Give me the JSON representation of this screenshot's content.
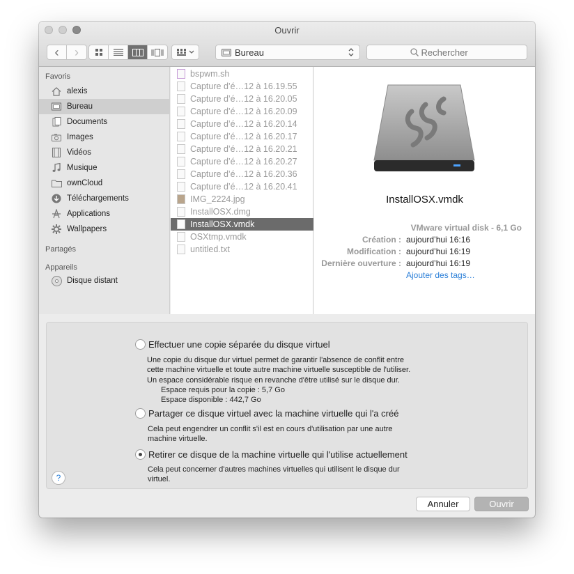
{
  "window": {
    "title": "Ouvrir"
  },
  "toolbar": {
    "back_glyph": "‹",
    "forward_glyph": "›",
    "location": "Bureau",
    "search_placeholder": "Rechercher"
  },
  "sidebar": {
    "favorites_header": "Favoris",
    "favorites": [
      {
        "label": "alexis",
        "icon": "home-icon"
      },
      {
        "label": "Bureau",
        "icon": "desktop-icon",
        "selected": true
      },
      {
        "label": "Documents",
        "icon": "documents-icon"
      },
      {
        "label": "Images",
        "icon": "camera-icon"
      },
      {
        "label": "Vidéos",
        "icon": "film-icon"
      },
      {
        "label": "Musique",
        "icon": "music-icon"
      },
      {
        "label": "ownCloud",
        "icon": "folder-icon"
      },
      {
        "label": "Téléchargements",
        "icon": "download-icon"
      },
      {
        "label": "Applications",
        "icon": "applications-icon"
      },
      {
        "label": "Wallpapers",
        "icon": "gear-icon"
      }
    ],
    "shared_header": "Partagés",
    "devices_header": "Appareils",
    "devices": [
      {
        "label": "Disque distant",
        "icon": "disc-icon"
      }
    ]
  },
  "files": [
    {
      "name": "bspwm.sh"
    },
    {
      "name": "Capture d’é…12 à 16.19.55"
    },
    {
      "name": "Capture d’é…12 à 16.20.05"
    },
    {
      "name": "Capture d’é…12 à 16.20.09"
    },
    {
      "name": "Capture d’é…12 à 16.20.14"
    },
    {
      "name": "Capture d’é…12 à 16.20.17"
    },
    {
      "name": "Capture d’é…12 à 16.20.21"
    },
    {
      "name": "Capture d’é…12 à 16.20.27"
    },
    {
      "name": "Capture d’é…12 à 16.20.36"
    },
    {
      "name": "Capture d’é…12 à 16.20.41"
    },
    {
      "name": "IMG_2224.jpg"
    },
    {
      "name": "InstallOSX.dmg"
    },
    {
      "name": "InstallOSX.vmdk",
      "selected": true
    },
    {
      "name": "OSXtmp.vmdk"
    },
    {
      "name": "untitled.txt"
    }
  ],
  "preview": {
    "name": "InstallOSX.vmdk",
    "kind": "VMware virtual disk - 6,1 Go",
    "created_label": "Création :",
    "created_value": "aujourd’hui 16:16",
    "modified_label": "Modification :",
    "modified_value": "aujourd’hui 16:19",
    "opened_label": "Dernière ouverture :",
    "opened_value": "aujourd’hui 16:19",
    "tags_link": "Ajouter des tags…"
  },
  "options": {
    "copy_title": "Effectuer une copie séparée du disque virtuel",
    "copy_desc_1": "Une copie du disque dur virtuel permet de garantir l'absence de conflit entre",
    "copy_desc_2": "cette machine virtuelle et toute autre machine virtuelle susceptible de l'utiliser.",
    "copy_desc_3": "Un espace considérable risque en revanche d'être utilisé sur le disque dur.",
    "copy_required": "Espace requis pour la copie : 5,7 Go",
    "copy_available": "Espace disponible : 442,7 Go",
    "share_title": "Partager ce disque virtuel avec la machine virtuelle qui l'a créé",
    "share_desc_1": "Cela peut engendrer un conflit s'il est en cours d'utilisation par une autre",
    "share_desc_2": "machine virtuelle.",
    "remove_title": "Retirer ce disque de la machine virtuelle qui l'utilise actuellement",
    "remove_desc_1": "Cela peut concerner d'autres machines virtuelles qui utilisent le disque dur",
    "remove_desc_2": "virtuel.",
    "selected": "remove",
    "help_glyph": "?"
  },
  "buttons": {
    "cancel": "Annuler",
    "open": "Ouvrir"
  }
}
